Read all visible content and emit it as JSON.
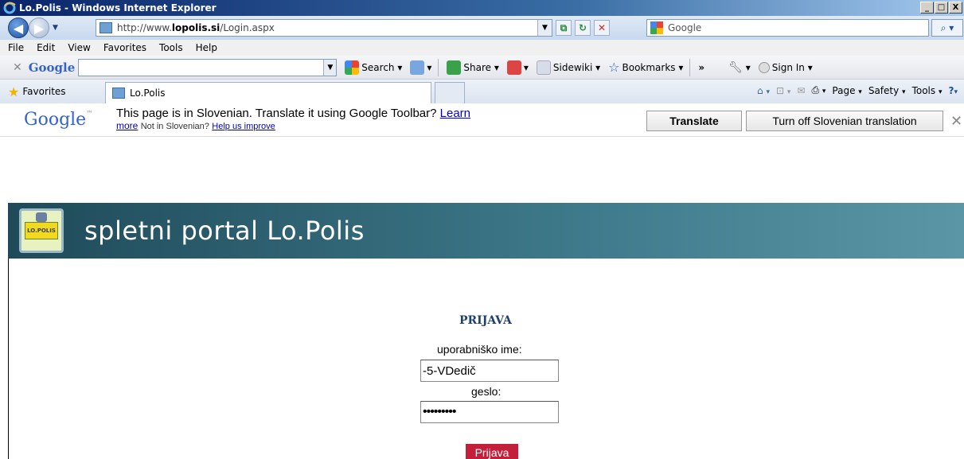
{
  "window": {
    "title": "Lo.Polis - Windows Internet Explorer",
    "controls": [
      "_",
      "□",
      "X"
    ]
  },
  "address": {
    "url_prefix": "http://www.",
    "url_bold": "lopolis.si",
    "url_suffix": "/Login.aspx"
  },
  "search": {
    "placeholder": "Google"
  },
  "menu": [
    "File",
    "Edit",
    "View",
    "Favorites",
    "Tools",
    "Help"
  ],
  "google_toolbar": {
    "logo": "Google",
    "items": [
      "Search",
      "Share",
      "Sidewiki",
      "Bookmarks",
      "Sign In"
    ]
  },
  "favorites": {
    "label": "Favorites",
    "tab_title": "Lo.Polis"
  },
  "command_bar": [
    "Page",
    "Safety",
    "Tools"
  ],
  "translate_bar": {
    "logo": "Google",
    "message": "This page is in Slovenian.  Translate it using Google Toolbar?",
    "learn": "Learn",
    "more": "more",
    "not_in": "Not in Slovenian?",
    "help": "Help us improve",
    "translate_btn": "Translate",
    "turnoff_btn": "Turn off Slovenian translation"
  },
  "page": {
    "logo_text": "LO.POLIS",
    "title": "spletni portal Lo.Polis",
    "login": {
      "heading": "PRIJAVA",
      "user_label": "uporabniško ime:",
      "user_value": "-5-VDedič",
      "pass_label": "geslo:",
      "pass_value": "•••••••••",
      "submit": "Prijava"
    }
  },
  "colors": {
    "header": "#2f6474",
    "submit": "#c41f3a",
    "heading": "#1f3f6f"
  }
}
